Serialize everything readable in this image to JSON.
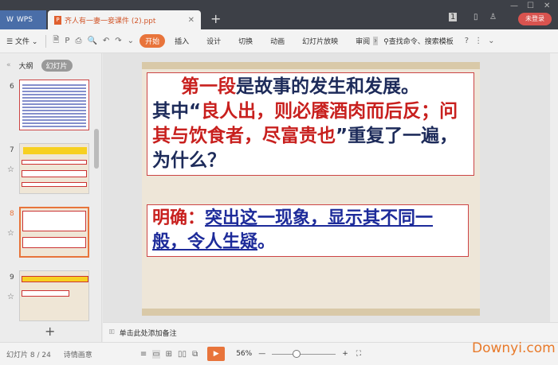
{
  "titlebar": {
    "app_tab": "WPS",
    "doc_tab": "齐人有一妻一妾课件 (2).ppt",
    "login": "未登录",
    "page_badge": "1"
  },
  "toolbar": {
    "file": "文件",
    "tabs": [
      "开始",
      "插入",
      "设计",
      "切换",
      "动画",
      "幻灯片放映",
      "审阅"
    ],
    "search": "查找命令、搜索模板"
  },
  "left_panel": {
    "tab_outline": "大纲",
    "tab_slides": "幻灯片",
    "slide_numbers": [
      "6",
      "7",
      "8",
      "9"
    ]
  },
  "slide": {
    "line1_red": "第一段",
    "line1_rest": "是故事的发生和发展。",
    "line2_a": "其中“",
    "line2_red": "良人出，则必餍酒肉而后反；问其与饮食者，尽富贵也",
    "line2_b": "”重复了一遍，为什么？",
    "answer_label": "明确：",
    "answer_text": "突出这一现象，显示其不同一般，令人生疑",
    "answer_end": "。"
  },
  "notes": {
    "placeholder": "单击此处添加备注"
  },
  "status": {
    "slide_pos": "幻灯片 8 / 24",
    "theme": "诗情画意",
    "zoom": "56%",
    "zoom_value": 56
  },
  "watermark": "Downyi.com"
}
